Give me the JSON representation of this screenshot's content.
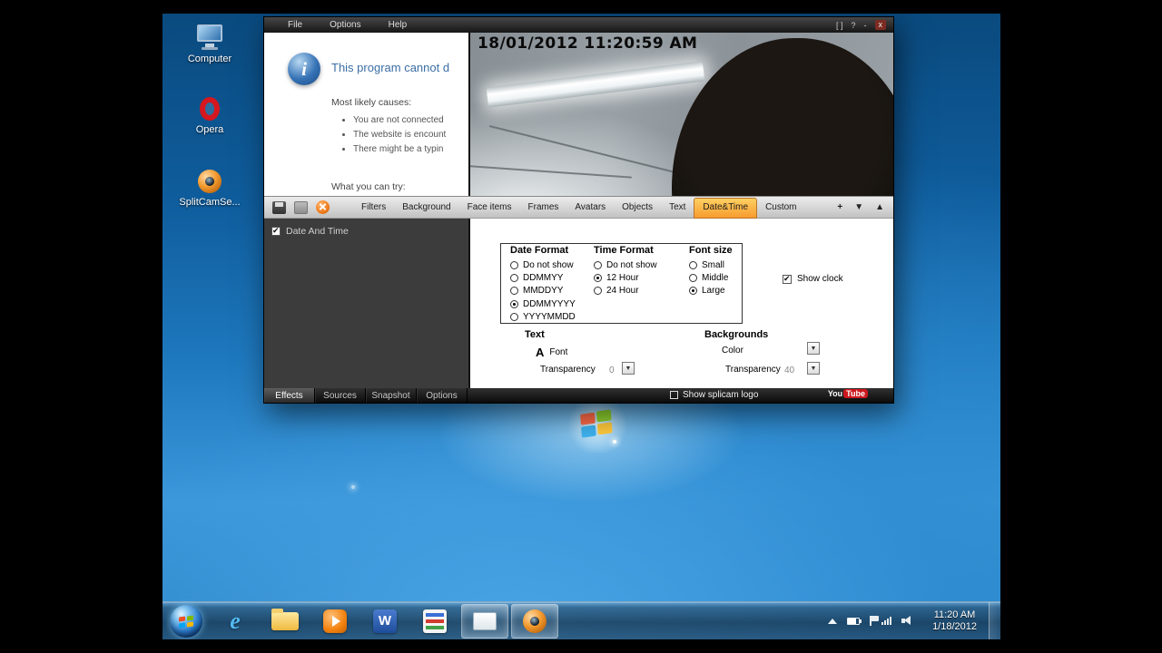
{
  "desktop": {
    "icons": [
      {
        "label": "Computer"
      },
      {
        "label": "Opera"
      },
      {
        "label": "SplitCamSe..."
      }
    ]
  },
  "app": {
    "menu": [
      "File",
      "Options",
      "Help"
    ],
    "controls": {
      "maximize": "[ ]",
      "help": "?",
      "minimize": "-",
      "close": "x"
    },
    "browser": {
      "title": "This program cannot d",
      "causes_heading": "Most likely causes:",
      "causes": [
        "You are not connected",
        "The website is encount",
        "There might be a typin"
      ],
      "try_heading": "What you can try:"
    },
    "video": {
      "timestamp": "18/01/2012 11:20:59 AM"
    },
    "tabs": [
      "Filters",
      "Background",
      "Face items",
      "Frames",
      "Avatars",
      "Objects",
      "Text",
      "Date&Time",
      "Custom"
    ],
    "active_tab": "Date&Time",
    "toolbar_icons": {
      "plus": "+",
      "down": "▼",
      "up": "▲"
    },
    "list_item": "Date And Time",
    "settings": {
      "date_format": {
        "heading": "Date Format",
        "options": [
          "Do not show",
          "DDMMYY",
          "MMDDYY",
          "DDMMYYYY",
          "YYYYMMDD"
        ],
        "selected": "DDMMYYYY"
      },
      "time_format": {
        "heading": "Time Format",
        "options": [
          "Do not show",
          "12 Hour",
          "24 Hour"
        ],
        "selected": "12 Hour"
      },
      "font_size": {
        "heading": "Font size",
        "options": [
          "Small",
          "Middle",
          "Large"
        ],
        "selected": "Large"
      },
      "show_clock": "Show clock",
      "dropdown_glyph": "▼",
      "text_group": {
        "heading": "Text",
        "font_glyph": "A",
        "font_label": "Font",
        "transparency_label": "Transparency",
        "transparency_value": "0"
      },
      "background_group": {
        "heading": "Backgrounds",
        "color_label": "Color",
        "transparency_label": "Transparency",
        "transparency_value": "40"
      }
    },
    "bottom_tabs": [
      "Effects",
      "Sources",
      "Snapshot",
      "Options"
    ],
    "active_bottom_tab": "Effects",
    "show_logo_label": "Show splicam logo",
    "youtube": {
      "you": "You",
      "tube": "Tube"
    }
  },
  "taskbar": {
    "icons": {
      "ie_glyph": "e",
      "word_glyph": "W"
    },
    "clock_time": "11:20 AM",
    "clock_date": "1/18/2012"
  }
}
